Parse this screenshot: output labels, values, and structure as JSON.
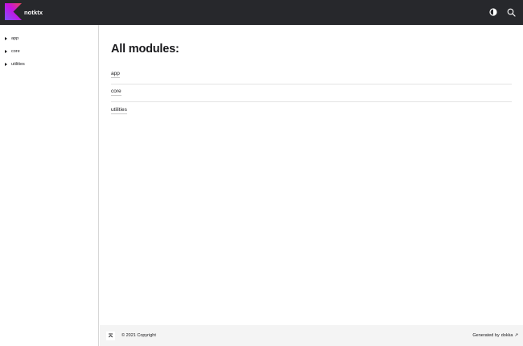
{
  "header": {
    "app_name": "notktx",
    "theme_toggle_icon": "half-circle-icon",
    "search_icon": "search-icon",
    "background": "#27282c"
  },
  "sidebar": {
    "items": [
      {
        "label": "app"
      },
      {
        "label": "core"
      },
      {
        "label": "utilities"
      }
    ]
  },
  "main": {
    "title": "All modules:",
    "modules": [
      {
        "name": "app"
      },
      {
        "name": "core"
      },
      {
        "name": "utilities"
      }
    ]
  },
  "footer": {
    "copyright": "© 2021 Copyright",
    "generated_prefix": "Generated by",
    "generated_link": "dokka",
    "external_link_icon": "arrow-up-right-icon"
  },
  "colors": {
    "logo_gradient": [
      "#7f52ff",
      "#e44857"
    ],
    "text": "#19191c"
  }
}
